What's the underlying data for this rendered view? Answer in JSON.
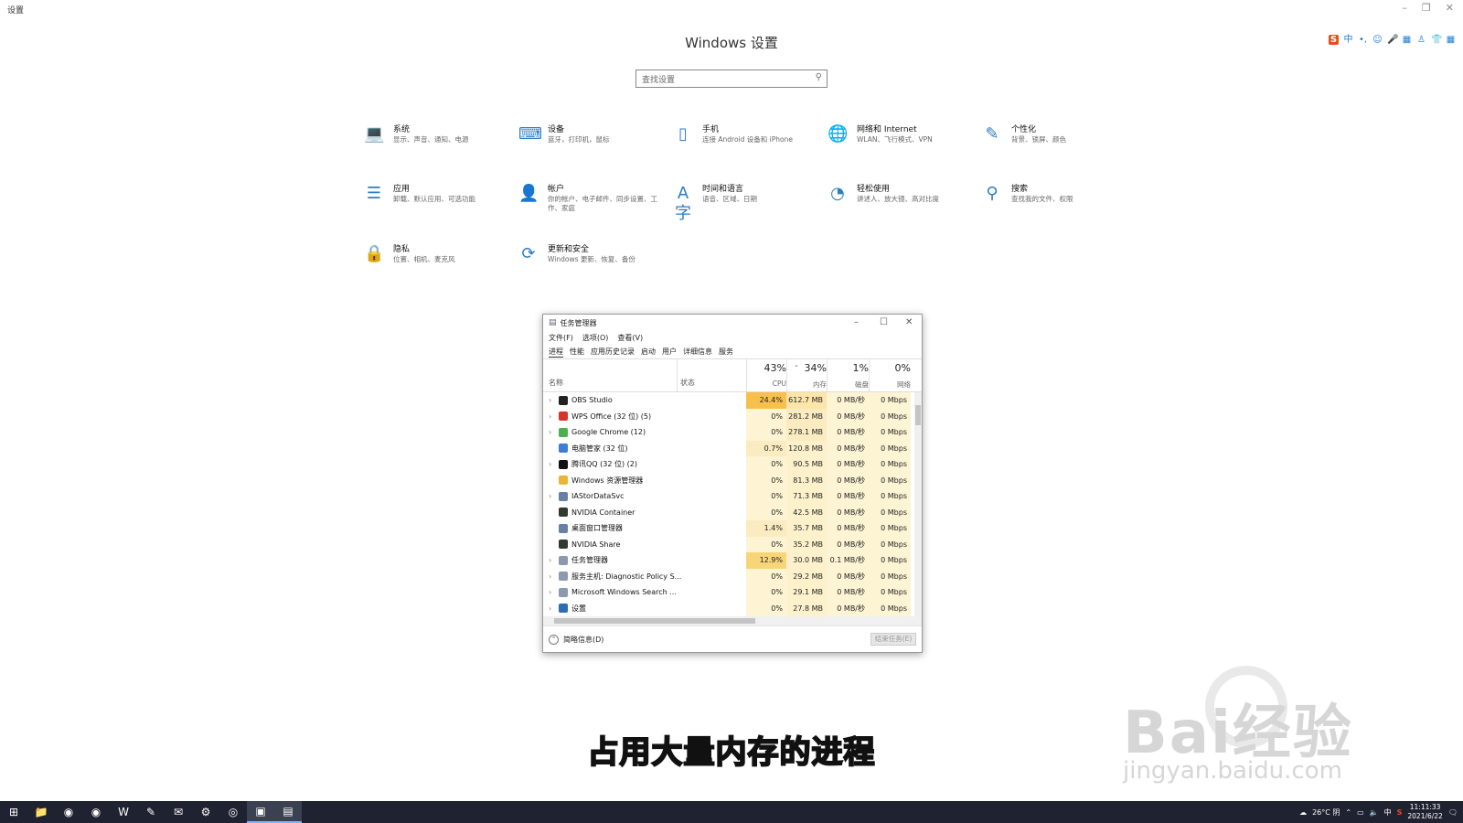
{
  "window": {
    "title": "设置",
    "controls": [
      "–",
      "❐",
      "✕"
    ]
  },
  "ime_bar": [
    "S",
    "中",
    "•,",
    "☺",
    "🎤",
    "▦",
    "♙",
    "👕",
    "▦"
  ],
  "settings": {
    "title": "Windows 设置",
    "search_placeholder": "查找设置",
    "tiles": [
      {
        "icon": "laptop-icon",
        "glyph": "💻",
        "title": "系统",
        "desc": "显示、声音、通知、电源"
      },
      {
        "icon": "devices-icon",
        "glyph": "⌨",
        "title": "设备",
        "desc": "蓝牙，打印机，鼠标"
      },
      {
        "icon": "phone-icon",
        "glyph": "▯",
        "title": "手机",
        "desc": "连接 Android 设备和 iPhone"
      },
      {
        "icon": "globe-icon",
        "glyph": "🌐",
        "title": "网络和 Internet",
        "desc": "WLAN、飞行模式、VPN"
      },
      {
        "icon": "personalization-icon",
        "glyph": "✎",
        "title": "个性化",
        "desc": "背景、锁屏、颜色"
      },
      {
        "icon": "apps-icon",
        "glyph": "☰",
        "title": "应用",
        "desc": "卸载、默认应用、可选功能"
      },
      {
        "icon": "account-icon",
        "glyph": "👤",
        "title": "帐户",
        "desc": "你的帐户、电子邮件、同步设置、工作、家庭"
      },
      {
        "icon": "time-language-icon",
        "glyph": "A字",
        "title": "时间和语言",
        "desc": "语音、区域、日期"
      },
      {
        "icon": "ease-of-access-icon",
        "glyph": "◔",
        "title": "轻松使用",
        "desc": "讲述人、放大镜、高对比度"
      },
      {
        "icon": "search-icon",
        "glyph": "⚲",
        "title": "搜索",
        "desc": "查找我的文件、权限"
      },
      {
        "icon": "lock-icon",
        "glyph": "🔒",
        "title": "隐私",
        "desc": "位置、相机、麦克风"
      },
      {
        "icon": "update-icon",
        "glyph": "⟳",
        "title": "更新和安全",
        "desc": "Windows 更新、恢复、备份"
      }
    ]
  },
  "task_manager": {
    "title": "任务管理器",
    "menu": [
      "文件(F)",
      "选项(O)",
      "查看(V)"
    ],
    "tabs": [
      "进程",
      "性能",
      "应用历史记录",
      "启动",
      "用户",
      "详细信息",
      "服务"
    ],
    "columns": {
      "name": "名称",
      "status": "状态",
      "cpu": {
        "pct": "43%",
        "label": "CPU"
      },
      "mem": {
        "pct": "34%",
        "label": "内存"
      },
      "disk": {
        "pct": "1%",
        "label": "磁盘"
      },
      "net": {
        "pct": "0%",
        "label": "网络"
      }
    },
    "rows": [
      {
        "expand": true,
        "icon_color": "#222222",
        "name": "OBS Studio",
        "cpu": "24.4%",
        "mem": "612.7 MB",
        "disk": "0 MB/秒",
        "net": "0 Mbps",
        "cpu_heat": "#F7C04D",
        "mem_heat": "#FBE5A9"
      },
      {
        "expand": true,
        "icon_color": "#D8342B",
        "name": "WPS Office (32 位) (5)",
        "cpu": "0%",
        "mem": "281.2 MB",
        "disk": "0 MB/秒",
        "net": "0 Mbps",
        "cpu_heat": "#FDF4D4",
        "mem_heat": "#FBEBC0"
      },
      {
        "expand": true,
        "icon_color": "#4CAF50",
        "name": "Google Chrome (12)",
        "cpu": "0%",
        "mem": "278.1 MB",
        "disk": "0 MB/秒",
        "net": "0 Mbps",
        "cpu_heat": "#FDF4D4",
        "mem_heat": "#FBEBC0"
      },
      {
        "expand": false,
        "icon_color": "#3B7DD8",
        "name": "电脑管家 (32 位)",
        "cpu": "0.7%",
        "mem": "120.8 MB",
        "disk": "0 MB/秒",
        "net": "0 Mbps",
        "cpu_heat": "#FBEBC0",
        "mem_heat": "#FDF1CC"
      },
      {
        "expand": true,
        "icon_color": "#111111",
        "name": "腾讯QQ (32 位) (2)",
        "cpu": "0%",
        "mem": "90.5 MB",
        "disk": "0 MB/秒",
        "net": "0 Mbps",
        "cpu_heat": "#FDF4D4",
        "mem_heat": "#FDF1CC"
      },
      {
        "expand": false,
        "icon_color": "#E8B53A",
        "name": "Windows 资源管理器",
        "cpu": "0%",
        "mem": "81.3 MB",
        "disk": "0 MB/秒",
        "net": "0 Mbps",
        "cpu_heat": "#FDF4D4",
        "mem_heat": "#FDF1CC"
      },
      {
        "expand": true,
        "icon_color": "#6A7FA6",
        "name": "IAStorDataSvc",
        "cpu": "0%",
        "mem": "71.3 MB",
        "disk": "0 MB/秒",
        "net": "0 Mbps",
        "cpu_heat": "#FDF4D4",
        "mem_heat": "#FDF1CC"
      },
      {
        "expand": false,
        "icon_color": "#2E3B2E",
        "name": "NVIDIA Container",
        "cpu": "0%",
        "mem": "42.5 MB",
        "disk": "0 MB/秒",
        "net": "0 Mbps",
        "cpu_heat": "#FDF4D4",
        "mem_heat": "#FDF1CC"
      },
      {
        "expand": false,
        "icon_color": "#6A7FA6",
        "name": "桌面窗口管理器",
        "cpu": "1.4%",
        "mem": "35.7 MB",
        "disk": "0 MB/秒",
        "net": "0 Mbps",
        "cpu_heat": "#FBEBC0",
        "mem_heat": "#FDF1CC"
      },
      {
        "expand": false,
        "icon_color": "#2E3B2E",
        "name": "NVIDIA Share",
        "cpu": "0%",
        "mem": "35.2 MB",
        "disk": "0 MB/秒",
        "net": "0 Mbps",
        "cpu_heat": "#FDF4D4",
        "mem_heat": "#FDF1CC"
      },
      {
        "expand": true,
        "icon_color": "#8C9AAF",
        "name": "任务管理器",
        "cpu": "12.9%",
        "mem": "30.0 MB",
        "disk": "0.1 MB/秒",
        "net": "0 Mbps",
        "cpu_heat": "#F9D57A",
        "mem_heat": "#FDF1CC"
      },
      {
        "expand": true,
        "icon_color": "#8C9AAF",
        "name": "服务主机: Diagnostic Policy S...",
        "cpu": "0%",
        "mem": "29.2 MB",
        "disk": "0 MB/秒",
        "net": "0 Mbps",
        "cpu_heat": "#FDF4D4",
        "mem_heat": "#FDF1CC"
      },
      {
        "expand": true,
        "icon_color": "#8C9AAF",
        "name": "Microsoft Windows Search ...",
        "cpu": "0%",
        "mem": "29.1 MB",
        "disk": "0 MB/秒",
        "net": "0 Mbps",
        "cpu_heat": "#FDF4D4",
        "mem_heat": "#FDF1CC"
      },
      {
        "expand": true,
        "icon_color": "#2C6BB5",
        "name": "设置",
        "cpu": "0%",
        "mem": "27.8 MB",
        "disk": "0 MB/秒",
        "net": "0 Mbps",
        "cpu_heat": "#FDF4D4",
        "mem_heat": "#FDF1CC"
      }
    ],
    "fewer_details": "简略信息(D)",
    "end_task": "结束任务(E)"
  },
  "caption": "占用大量内存的进程",
  "watermark": {
    "brand": "Bai经验",
    "url": "jingyan.baidu.com"
  },
  "taskbar": {
    "apps": [
      {
        "name": "start-icon",
        "glyph": "⊞",
        "active": false
      },
      {
        "name": "file-explorer-icon",
        "glyph": "📁",
        "active": false
      },
      {
        "name": "chrome-icon",
        "glyph": "◉",
        "active": false
      },
      {
        "name": "chrome-alt-icon",
        "glyph": "◉",
        "active": false
      },
      {
        "name": "wps-icon",
        "glyph": "W",
        "active": false
      },
      {
        "name": "app-icon",
        "glyph": "✎",
        "active": false
      },
      {
        "name": "mail-icon",
        "glyph": "✉",
        "active": false
      },
      {
        "name": "settings-icon",
        "glyph": "⚙",
        "active": false
      },
      {
        "name": "obs-icon",
        "glyph": "◎",
        "active": false
      },
      {
        "name": "app2-icon",
        "glyph": "▣",
        "active": true
      },
      {
        "name": "task-manager-icon",
        "glyph": "▤",
        "active": true
      }
    ],
    "weather": "26°C 阴",
    "ime": "中",
    "time": "11:11:33",
    "date": "2021/6/22"
  }
}
